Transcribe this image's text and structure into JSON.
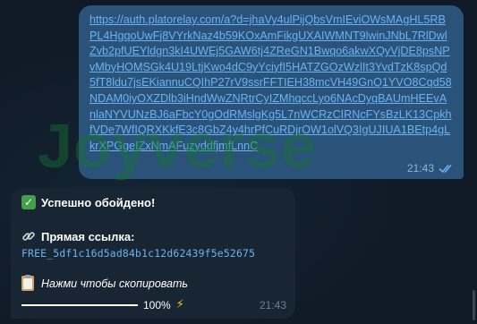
{
  "watermark": "Joyverse",
  "outgoing": {
    "link": "https://auth.platorelay.com/a?d=jhaVy4ulPijQbsVmIEviOWsMAgHL5RBPL4HgqoUwFj8VYrkNaz4b59KOxAmFikgUXAIWMNT9lwinJNbL7RlDwlZvb2pfUEYldgn3kI4UWEj5GAW6tj4ZReGN1Bwqo6akwXQyVjDE8psNPvMbyHOMSGk4U19LtjKwo4dC9yYciyfI5HATZGOzWzlIt3YvdTzK8spQd5fT8ldu7jsEKiannuCQIhP27rV9ssrFFTIEH38mcVH49GnQ1YVO8Cqd58NDAM0iyOXZDlb3iHndWwZNRtrCyIZMhqccLyo6NAcDyqBAUmHEEvAnlaNYVUNzBJ6aFbcY0gOdRMslgKg5L7nWCRzCIRNcFYsBzLK13CpkhfVDe7WfIQRXKkfE3c8GbZ4y4hrPfCuRDjrOW1olVQ3IgUJIUA1BEtp4gLkrXPGgeIZxNmAFuzyddfjmfLnnC",
    "time": "21:43",
    "status_icon": "double-check-icon"
  },
  "incoming": {
    "success_icon": "check-mark-icon",
    "success_glyph": "✓",
    "success_text": "Успешно обойдено!",
    "link_icon": "link-icon",
    "link_label": "Прямая ссылка:",
    "code": "FREE_5df1c16d5ad84b1c12d62439f5e52675",
    "copy_icon": "clipboard-icon",
    "copy_text": "Нажми чтобы скопировать",
    "progress": 100,
    "progress_text": "100%",
    "zap_icon": "high-voltage-icon",
    "zap_glyph": "⚡",
    "time": "21:43"
  },
  "colors": {
    "outgoing_bubble": "#2b5278",
    "incoming_bubble": "#182533",
    "link": "#6ab3f3",
    "background": "#0f1a26"
  }
}
